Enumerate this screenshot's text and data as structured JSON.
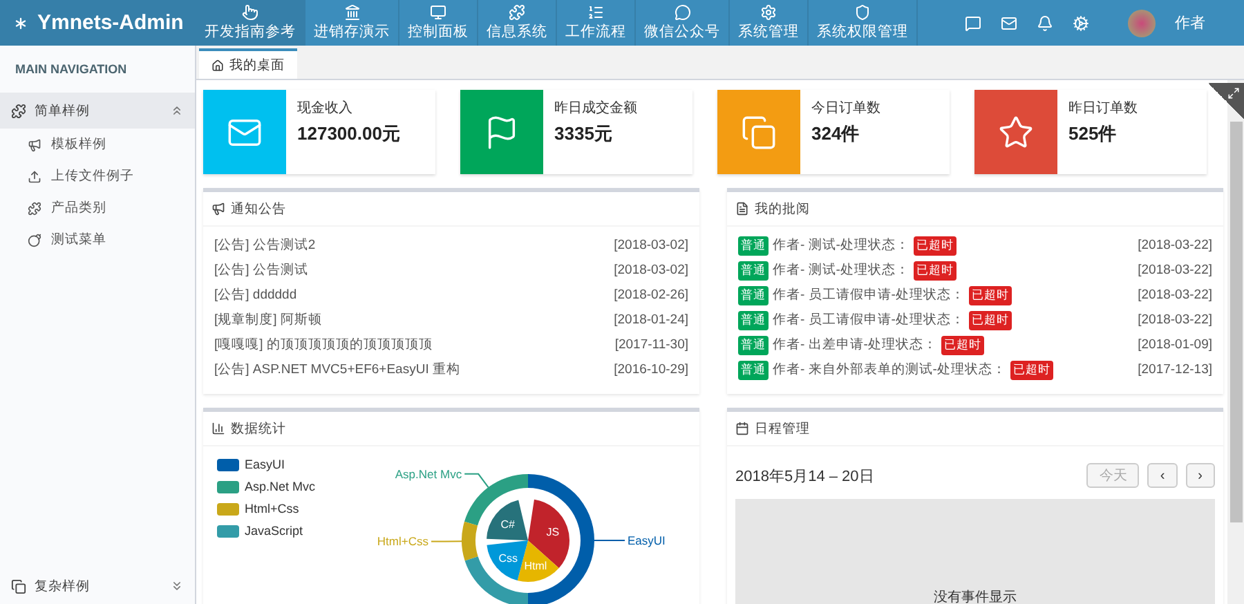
{
  "header": {
    "logo": "Ymnets-Admin",
    "nav": [
      {
        "label": "开发指南参考",
        "selected": true
      },
      {
        "label": "进销存演示",
        "selected": false
      },
      {
        "label": "控制面板",
        "selected": false
      },
      {
        "label": "信息系统",
        "selected": false
      },
      {
        "label": "工作流程",
        "selected": false
      },
      {
        "label": "微信公众号",
        "selected": false
      },
      {
        "label": "系统管理",
        "selected": false
      },
      {
        "label": "系统权限管理",
        "selected": false
      }
    ],
    "user": "作者"
  },
  "sidebar": {
    "heading": "MAIN NAVIGATION",
    "groups": [
      {
        "label": "简单样例",
        "expanded": true,
        "children": [
          {
            "label": "模板样例"
          },
          {
            "label": "上传文件例子"
          },
          {
            "label": "产品类别"
          },
          {
            "label": "测试菜单"
          }
        ]
      },
      {
        "label": "复杂样例",
        "expanded": false
      }
    ]
  },
  "tabs": [
    {
      "label": "我的桌面",
      "selected": true
    }
  ],
  "stats": [
    {
      "label": "现金收入",
      "value": "127300.00元",
      "color": "#00c0ef"
    },
    {
      "label": "昨日成交金额",
      "value": "3335元",
      "color": "#00a65a"
    },
    {
      "label": "今日订单数",
      "value": "324件",
      "color": "#f39c12"
    },
    {
      "label": "昨日订单数",
      "value": "525件",
      "color": "#dd4b39"
    }
  ],
  "notices": {
    "title": "通知公告",
    "items": [
      {
        "text": "[公告] 公告测试2",
        "date": "[2018-03-02]"
      },
      {
        "text": "[公告] 公告测试",
        "date": "[2018-03-02]"
      },
      {
        "text": "[公告] dddddd",
        "date": "[2018-02-26]"
      },
      {
        "text": "[规章制度] 阿斯顿",
        "date": "[2018-01-24]"
      },
      {
        "text": "[嘎嘎嘎] 的顶顶顶顶顶的顶顶顶顶顶",
        "date": "[2017-11-30]"
      },
      {
        "text": "[公告] ASP.NET MVC5+EF6+EasyUI 重构",
        "date": "[2016-10-29]"
      }
    ]
  },
  "approvals": {
    "title": "我的批阅",
    "items": [
      {
        "tag": "普通",
        "text": "作者- 测试-处理状态：",
        "status": "已超时",
        "date": "[2018-03-22]"
      },
      {
        "tag": "普通",
        "text": "作者- 测试-处理状态：",
        "status": "已超时",
        "date": "[2018-03-22]"
      },
      {
        "tag": "普通",
        "text": "作者- 员工请假申请-处理状态：",
        "status": "已超时",
        "date": "[2018-03-22]"
      },
      {
        "tag": "普通",
        "text": "作者- 员工请假申请-处理状态：",
        "status": "已超时",
        "date": "[2018-03-22]"
      },
      {
        "tag": "普通",
        "text": "作者- 出差申请-处理状态：",
        "status": "已超时",
        "date": "[2018-01-09]"
      },
      {
        "tag": "普通",
        "text": "作者- 来自外部表单的测试-处理状态：",
        "status": "已超时",
        "date": "[2017-12-13]"
      }
    ]
  },
  "stats_panel": {
    "title": "数据统计",
    "legend": [
      {
        "label": "EasyUI",
        "color": "#005eaa"
      },
      {
        "label": "Asp.Net Mvc",
        "color": "#2ba084"
      },
      {
        "label": "Html+Css",
        "color": "#c9a81a"
      },
      {
        "label": "JavaScript",
        "color": "#339ca8"
      }
    ],
    "outer_labels": [
      {
        "label": "EasyUI",
        "color": "#005eaa"
      },
      {
        "label": "Asp.Net Mvc",
        "color": "#2ba084"
      },
      {
        "label": "Html+Css",
        "color": "#c9a81a"
      }
    ],
    "inner": [
      {
        "label": "JS",
        "color": "#c1232b"
      },
      {
        "label": "Html",
        "color": "#e6b600"
      },
      {
        "label": "Css",
        "color": "#0098d9"
      },
      {
        "label": "C#",
        "color": "#27727b"
      }
    ]
  },
  "schedule": {
    "title": "日程管理",
    "range": "2018年5月14 – 20日",
    "today": "今天",
    "prev": "‹",
    "next": "›",
    "empty": "没有事件显示"
  }
}
